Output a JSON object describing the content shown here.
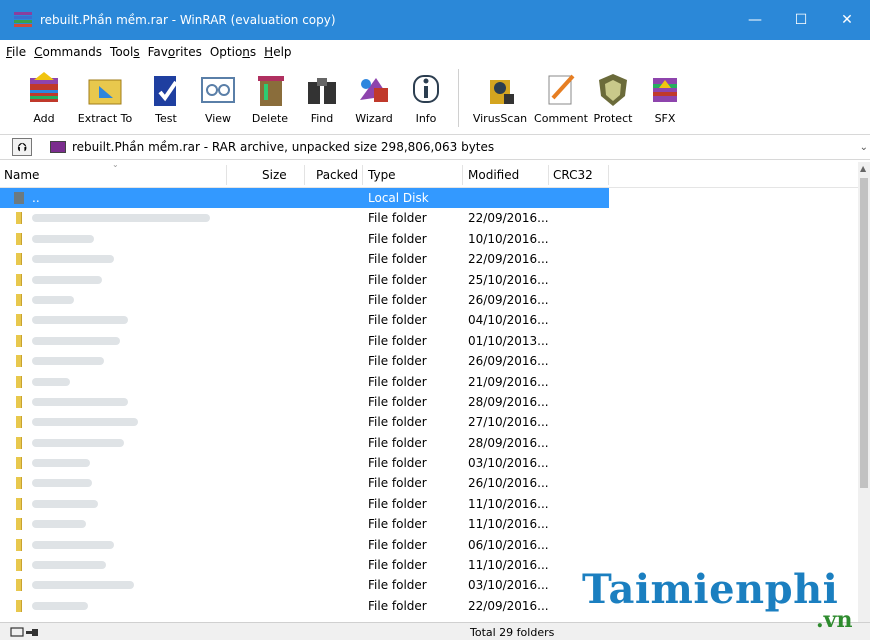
{
  "window": {
    "title": "rebuilt.Phần mềm.rar - WinRAR (evaluation copy)",
    "controls": [
      "—",
      "☐",
      "✕"
    ]
  },
  "menu": [
    "File",
    "Commands",
    "Tools",
    "Favorites",
    "Options",
    "Help"
  ],
  "menu_access_keys": [
    "F",
    "C",
    "s",
    "o",
    "n",
    "H"
  ],
  "toolbar": [
    {
      "label": "Add",
      "icon": "add-icon"
    },
    {
      "label": "Extract To",
      "icon": "extract-icon"
    },
    {
      "label": "Test",
      "icon": "test-icon"
    },
    {
      "label": "View",
      "icon": "view-icon"
    },
    {
      "label": "Delete",
      "icon": "delete-icon"
    },
    {
      "label": "Find",
      "icon": "find-icon"
    },
    {
      "label": "Wizard",
      "icon": "wizard-icon"
    },
    {
      "label": "Info",
      "icon": "info-icon"
    },
    {
      "label": "VirusScan",
      "icon": "virusscan-icon"
    },
    {
      "label": "Comment",
      "icon": "comment-icon"
    },
    {
      "label": "Protect",
      "icon": "protect-icon"
    },
    {
      "label": "SFX",
      "icon": "sfx-icon"
    }
  ],
  "address": {
    "text": "rebuilt.Phần mềm.rar - RAR archive, unpacked size 298,806,063 bytes",
    "dropdown": "⌄"
  },
  "columns": {
    "name": "Name",
    "size": "Size",
    "packed": "Packed",
    "type": "Type",
    "modified": "Modified",
    "crc": "CRC32"
  },
  "up_row": {
    "name": "..",
    "type": "Local Disk"
  },
  "rows": [
    {
      "type": "File folder",
      "modified": "22/09/2016..."
    },
    {
      "type": "File folder",
      "modified": "10/10/2016..."
    },
    {
      "type": "File folder",
      "modified": "22/09/2016..."
    },
    {
      "type": "File folder",
      "modified": "25/10/2016..."
    },
    {
      "type": "File folder",
      "modified": "26/09/2016..."
    },
    {
      "type": "File folder",
      "modified": "04/10/2016..."
    },
    {
      "type": "File folder",
      "modified": "01/10/2013..."
    },
    {
      "type": "File folder",
      "modified": "26/09/2016..."
    },
    {
      "type": "File folder",
      "modified": "21/09/2016..."
    },
    {
      "type": "File folder",
      "modified": "28/09/2016..."
    },
    {
      "type": "File folder",
      "modified": "27/10/2016..."
    },
    {
      "type": "File folder",
      "modified": "28/09/2016..."
    },
    {
      "type": "File folder",
      "modified": "03/10/2016..."
    },
    {
      "type": "File folder",
      "modified": "26/10/2016..."
    },
    {
      "type": "File folder",
      "modified": "11/10/2016..."
    },
    {
      "type": "File folder",
      "modified": "11/10/2016..."
    },
    {
      "type": "File folder",
      "modified": "06/10/2016..."
    },
    {
      "type": "File folder",
      "modified": "11/10/2016..."
    },
    {
      "type": "File folder",
      "modified": "03/10/2016..."
    },
    {
      "type": "File folder",
      "modified": "22/09/2016..."
    }
  ],
  "status": {
    "text": "Total 29 folders"
  },
  "watermark": {
    "main": "Taimienphi",
    "suffix": ".vn"
  },
  "colors": {
    "titlebar": "#2b88d8",
    "selection": "#3399ff",
    "folder": "#e8c84d",
    "watermark_blue": "#1b7fc0",
    "watermark_green": "#2e8b2e"
  }
}
